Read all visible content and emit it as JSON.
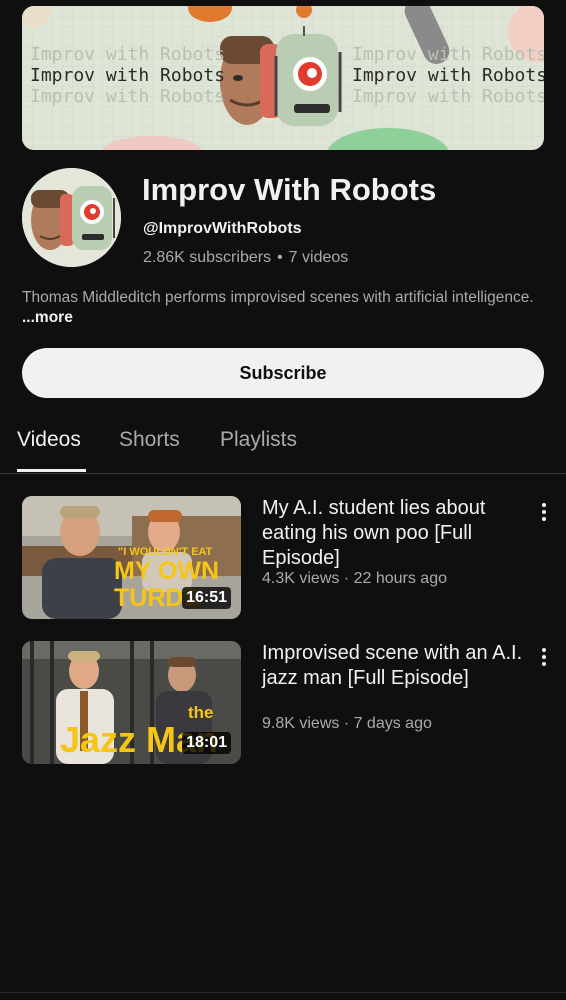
{
  "banner": {
    "text_lines": [
      "Improv with Robots",
      "Improv with Robots",
      "Improv with Robots"
    ]
  },
  "channel": {
    "name": "Improv With Robots",
    "handle": "@ImprovWithRobots",
    "subscribers": "2.86K subscribers",
    "separator": "•",
    "video_count": "7 videos",
    "description": "Thomas Middleditch performs improvised scenes with artificial intelligence.",
    "more_label": "...more"
  },
  "subscribe_label": "Subscribe",
  "tabs": [
    {
      "label": "Videos",
      "active": true
    },
    {
      "label": "Shorts",
      "active": false
    },
    {
      "label": "Playlists",
      "active": false
    }
  ],
  "videos": [
    {
      "title": "My A.I. student lies about eating his own poo [Full Episode]",
      "meta": "4.3K views · 22 hours ago",
      "duration": "16:51",
      "thumb_caption_small": "\"I WOULDN'T EAT",
      "thumb_caption_big1": "MY OWN",
      "thumb_caption_big2": "TURDS"
    },
    {
      "title": "Improvised scene with an A.I. jazz man [Full Episode]",
      "meta": "9.8K views · 7 days ago",
      "duration": "18:01",
      "thumb_caption_small": "the",
      "thumb_caption_big": "Jazz Man"
    }
  ],
  "colors": {
    "background": "#0f0f0f",
    "text_primary": "#f1f1f1",
    "text_secondary": "#aaaaaa",
    "subscribe_bg": "#f1f1f1",
    "thumb_caption_yellow": "#f5c518"
  }
}
